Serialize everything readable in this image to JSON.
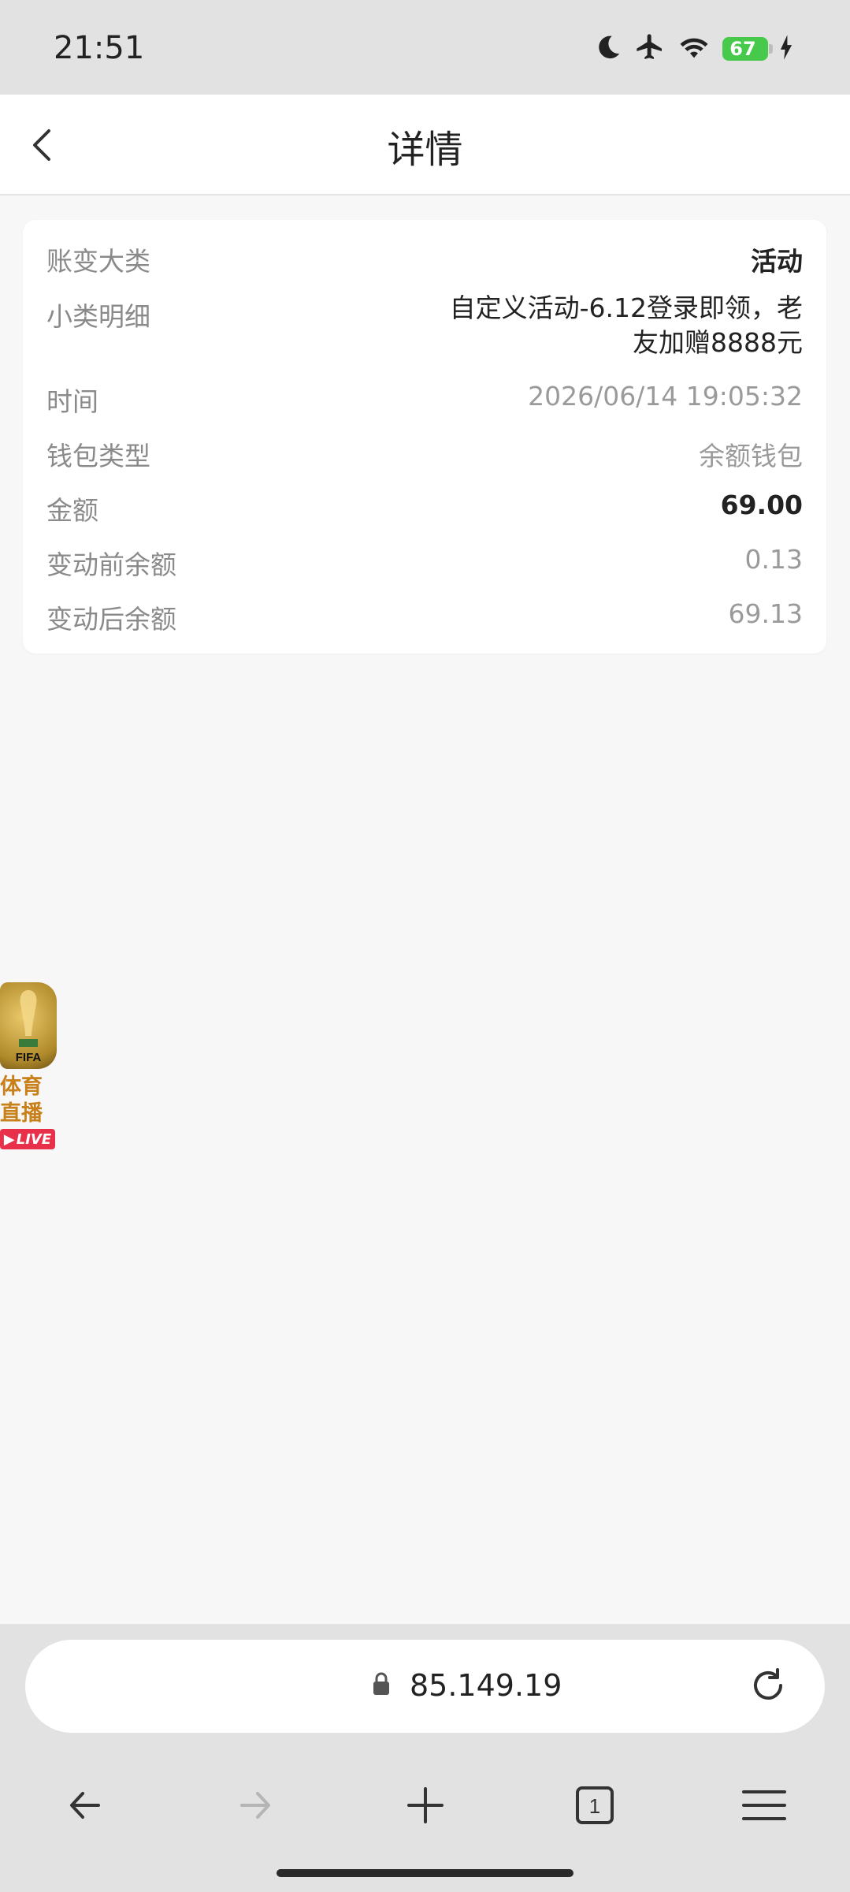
{
  "status_bar": {
    "time": "21:51",
    "battery_level": "67",
    "icons": [
      "moon-icon",
      "airplane-icon",
      "wifi-icon",
      "battery-icon",
      "charging-icon"
    ]
  },
  "header": {
    "title": "详情"
  },
  "details": [
    {
      "label": "账变大类",
      "value": "活动"
    },
    {
      "label": "小类明细",
      "value": "自定义活动-6.12登录即领，老友加赠8888元"
    },
    {
      "label": "时间",
      "value": "2026/06/14 19:05:32"
    },
    {
      "label": "钱包类型",
      "value": "余额钱包"
    },
    {
      "label": "金额",
      "value": "69.00"
    },
    {
      "label": "变动前余额",
      "value": "0.13"
    },
    {
      "label": "变动后余额",
      "value": "69.13"
    }
  ],
  "floating_badge": {
    "brand": "FIFA",
    "line1": "体育",
    "line2": "直播",
    "live": "LIVE"
  },
  "browser": {
    "url": "85.149.19",
    "tab_count": "1"
  },
  "colors": {
    "battery_green": "#47c94b",
    "live_red": "#e8304a",
    "badge_gold": "#c9801a"
  }
}
